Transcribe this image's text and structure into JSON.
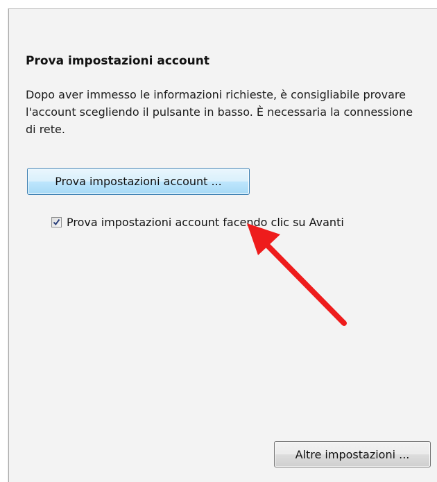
{
  "section": {
    "title": "Prova impostazioni account",
    "description": "Dopo aver immesso le informazioni richieste, è consigliabile provare l'account scegliendo il pulsante in basso. È necessaria la connessione di rete."
  },
  "buttons": {
    "test_account": "Prova impostazioni account ...",
    "more_settings": "Altre impostazioni ..."
  },
  "checkbox": {
    "label": "Prova impostazioni account facendo clic su Avanti",
    "checked": true
  },
  "annotation": {
    "type": "arrow",
    "color": "#ee1c1c"
  },
  "colors": {
    "panel_bg": "#f3f3f3",
    "button_focus_border": "#3c7fb1"
  }
}
